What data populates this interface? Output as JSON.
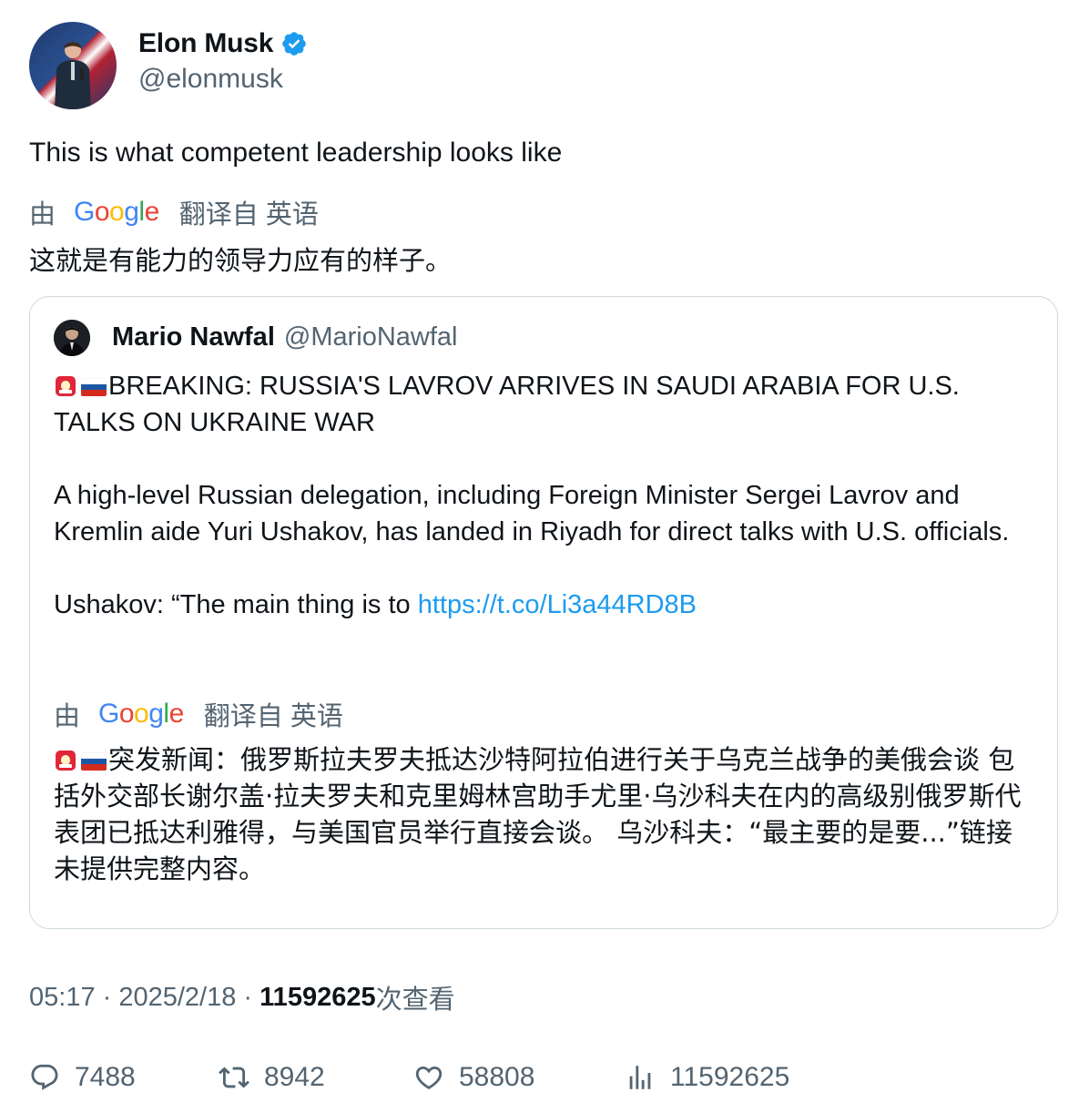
{
  "author": {
    "name": "Elon Musk",
    "handle": "@elonmusk",
    "avatar_icon": "profile-photo",
    "verified_icon": "verified-badge-icon"
  },
  "tweet": {
    "text": "This is what competent leadership looks like",
    "translation_by": "由",
    "translation_source": "翻译自 英语",
    "translated_text": "这就是有能力的领导力应有的样子。"
  },
  "quote": {
    "name": "Mario Nawfal",
    "handle": "@MarioNawfal",
    "headline": "BREAKING: RUSSIA'S LAVROV ARRIVES IN SAUDI ARABIA FOR U.S. TALKS ON UKRAINE WAR",
    "paragraph": "A high-level Russian delegation, including Foreign Minister Sergei Lavrov and Kremlin aide Yuri Ushakov, has landed in Riyadh for direct talks with U.S. officials.",
    "quote_prefix": "Ushakov: “The main thing is to ",
    "link": "https://t.co/Li3a44RD8B",
    "translation_by": "由",
    "translation_source": "翻译自 英语",
    "translated_text": "突发新闻：俄罗斯拉夫罗夫抵达沙特阿拉伯进行关于乌克兰战争的美俄会谈 包括外交部长谢尔盖·拉夫罗夫和克里姆林宫助手尤里·乌沙科夫在内的高级别俄罗斯代表团已抵达利雅得，与美国官员举行直接会谈。 乌沙科夫：“最主要的是要...”链接未提供完整内容。"
  },
  "meta": {
    "time": "05:17",
    "sep1": " · ",
    "date": "2025/2/18",
    "sep2": " · ",
    "views": "11592625",
    "views_label": "次查看"
  },
  "actions": {
    "replies": "7488",
    "retweets": "8942",
    "likes": "58808",
    "views": "11592625"
  },
  "colors": {
    "link": "#1d9bf0",
    "secondary_text": "#536471",
    "verified": "#1d9bf0"
  }
}
